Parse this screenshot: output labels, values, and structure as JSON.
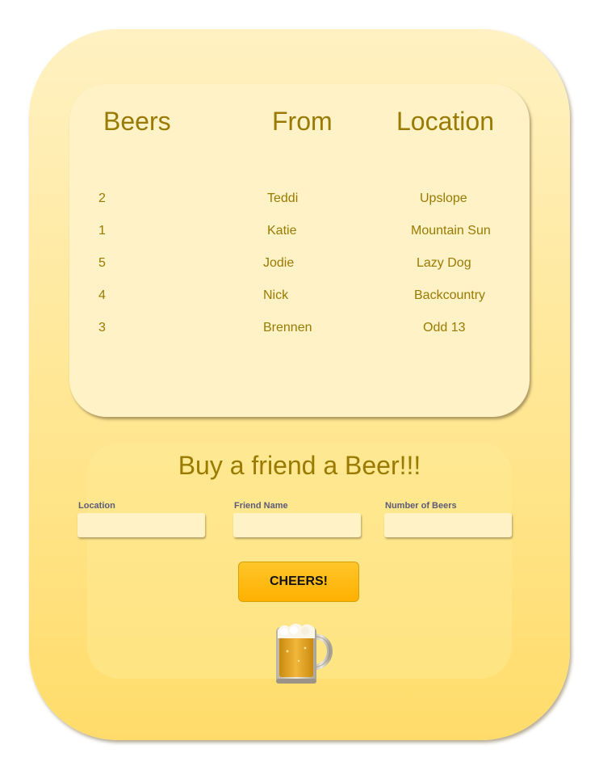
{
  "table": {
    "headers": {
      "beers": "Beers",
      "from": "From",
      "location": "Location"
    },
    "rows": [
      {
        "beers": "2",
        "from": "Teddi",
        "location": "Upslope"
      },
      {
        "beers": "1",
        "from": "Katie",
        "location": "Mountain Sun"
      },
      {
        "beers": "5",
        "from": "Jodie",
        "location": "Lazy Dog"
      },
      {
        "beers": "4",
        "from": "Nick",
        "location": "Backcountry"
      },
      {
        "beers": "3",
        "from": "Brennen",
        "location": "Odd 13"
      }
    ]
  },
  "form": {
    "title": "Buy a friend a Beer!!!",
    "location_label": "Location",
    "location_value": "",
    "friend_label": "Friend Name",
    "friend_value": "",
    "count_label": "Number of Beers",
    "count_value": "",
    "submit_label": "CHEERS!"
  },
  "icons": {
    "mug": "beer-mug-icon"
  },
  "colors": {
    "text_gold": "#9a7a00",
    "button": "#ffb000",
    "panel": "#fff2c6"
  }
}
